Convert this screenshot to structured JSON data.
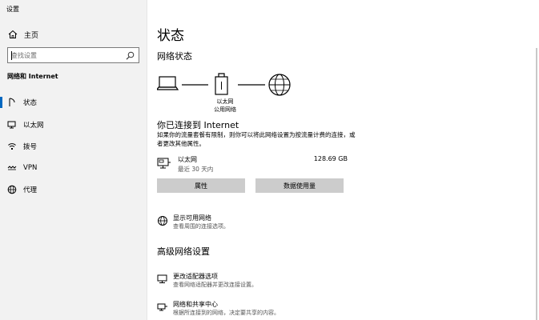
{
  "window": {
    "title": "设置",
    "minimize": "—",
    "maximize": "☐",
    "close": "✕"
  },
  "sidebar": {
    "home_label": "主页",
    "search_placeholder": "查找设置",
    "section_title": "网络和 Internet",
    "items": [
      {
        "label": "状态",
        "icon": "status-icon",
        "active": true
      },
      {
        "label": "以太网",
        "icon": "ethernet-icon",
        "active": false
      },
      {
        "label": "拨号",
        "icon": "dialup-icon",
        "active": false
      },
      {
        "label": "VPN",
        "icon": "vpn-icon",
        "active": false
      },
      {
        "label": "代理",
        "icon": "proxy-icon",
        "active": false
      }
    ]
  },
  "main": {
    "page_title": "状态",
    "network_status_title": "网络状态",
    "diagram_label": "以太网\n公用网络",
    "connected_title": "你已连接到 Internet",
    "connected_desc": "如果你的流量套餐有限制，则你可以将此网络设置为按流量计费的连接，或者更改其他属性。",
    "ethernet": {
      "name": "以太网",
      "time": "最近 30 天内",
      "usage": "128.69 GB"
    },
    "buttons": {
      "properties": "属性",
      "data_usage": "数据使用量"
    },
    "show_networks": {
      "title": "显示可用网络",
      "desc": "查看周围的连接选项。"
    },
    "advanced_title": "高级网络设置",
    "adapter_options": {
      "title": "更改适配器选项",
      "desc": "查看网络适配器并更改连接设置。"
    },
    "sharing_center": {
      "title": "网络和共享中心",
      "desc": "根据所连接到的网络，决定要共享的内容。"
    }
  }
}
